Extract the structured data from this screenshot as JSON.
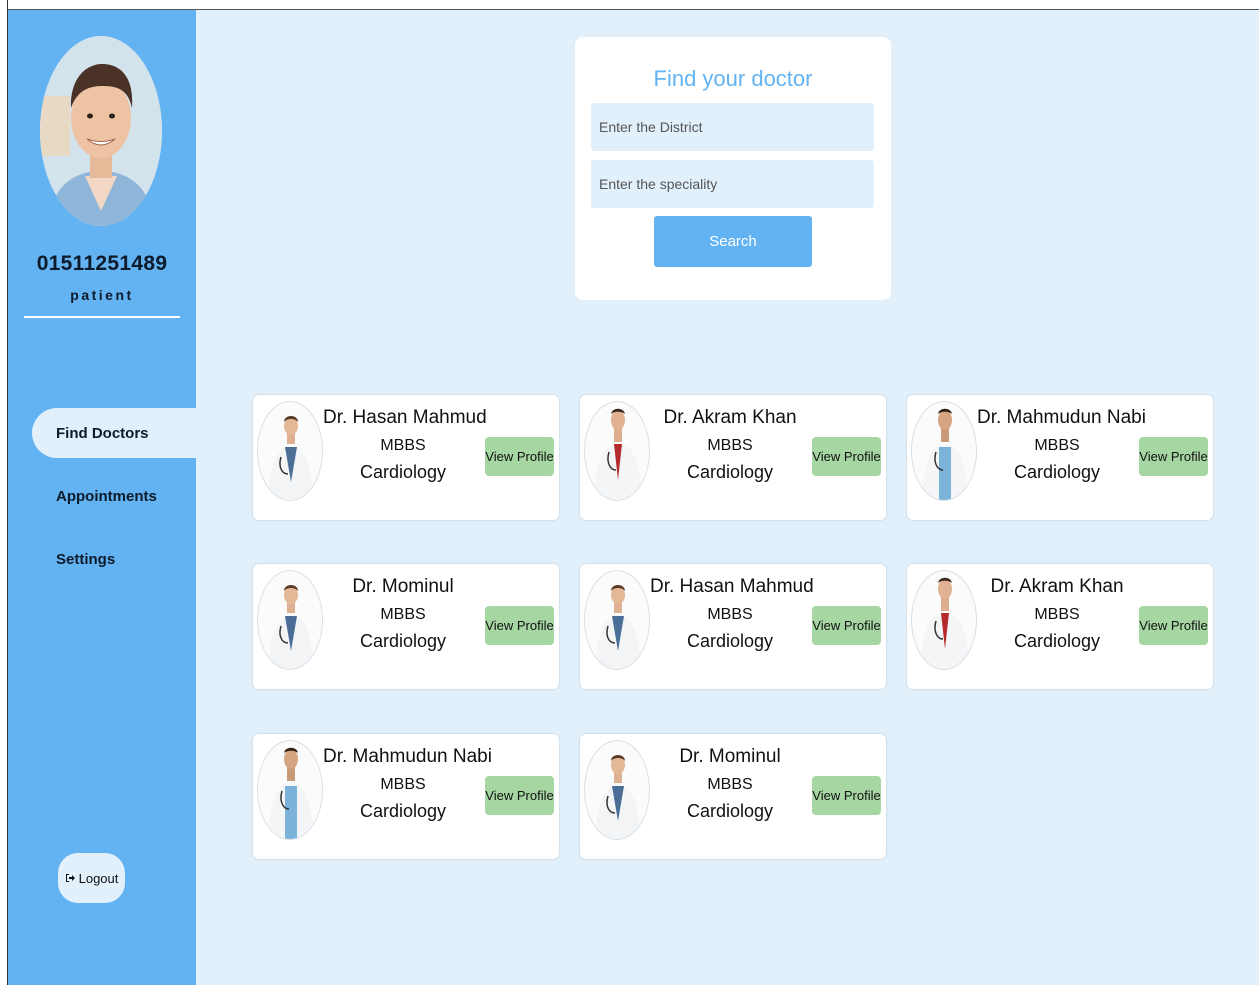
{
  "profile": {
    "phone": "01511251489",
    "role": "patient"
  },
  "nav": {
    "items": [
      {
        "label": "Find Doctors",
        "active": true
      },
      {
        "label": "Appointments",
        "active": false
      },
      {
        "label": "Settings",
        "active": false
      }
    ],
    "logout_label": "Logout"
  },
  "search": {
    "title": "Find your doctor",
    "district_placeholder": "Enter the District",
    "speciality_placeholder": "Enter the speciality",
    "button_label": "Search"
  },
  "doctors": [
    {
      "name": "Dr. Hasan Mahmud",
      "degree": "MBBS",
      "specialty": "Cardiology",
      "button": "View Profile"
    },
    {
      "name": "Dr. Akram Khan",
      "degree": "MBBS",
      "specialty": "Cardiology",
      "button": "View Profile"
    },
    {
      "name": "Dr. Mahmudun Nabi",
      "degree": "MBBS",
      "specialty": "Cardiology",
      "button": "View Profile"
    },
    {
      "name": "Dr. Mominul",
      "degree": "MBBS",
      "specialty": "Cardiology",
      "button": "View Profile"
    },
    {
      "name": "Dr. Hasan Mahmud",
      "degree": "MBBS",
      "specialty": "Cardiology",
      "button": "View Profile"
    },
    {
      "name": "Dr. Akram Khan",
      "degree": "MBBS",
      "specialty": "Cardiology",
      "button": "View Profile"
    },
    {
      "name": "Dr. Mahmudun Nabi",
      "degree": "MBBS",
      "specialty": "Cardiology",
      "button": "View Profile"
    },
    {
      "name": "Dr. Mominul",
      "degree": "MBBS",
      "specialty": "Cardiology",
      "button": "View Profile"
    }
  ],
  "colors": {
    "primary": "#63b3f2",
    "background": "#e2f0fc",
    "view_button": "#a6d6a2"
  }
}
